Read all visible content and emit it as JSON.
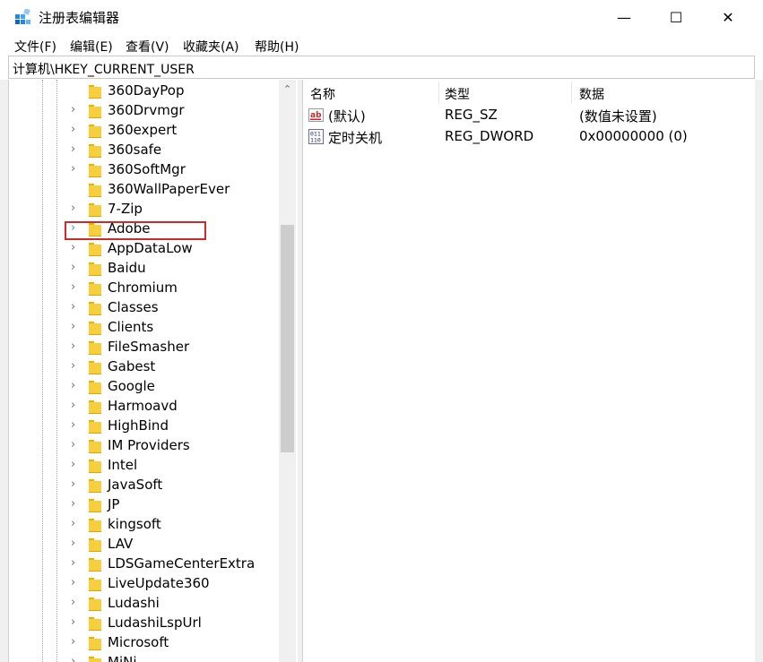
{
  "window": {
    "title": "注册表编辑器",
    "minimize_glyph": "—",
    "maximize_glyph": "☐",
    "close_glyph": "✕"
  },
  "menu": [
    "文件(F)",
    "编辑(E)",
    "查看(V)",
    "收藏夹(A)",
    "帮助(H)"
  ],
  "address": "计算机\\HKEY_CURRENT_USER",
  "tree": {
    "items": [
      {
        "label": "360DayPop",
        "expandable": false
      },
      {
        "label": "360Drvmgr",
        "expandable": true
      },
      {
        "label": "360expert",
        "expandable": true
      },
      {
        "label": "360safe",
        "expandable": true
      },
      {
        "label": "360SoftMgr",
        "expandable": true
      },
      {
        "label": "360WallPaperEver",
        "expandable": false
      },
      {
        "label": "7-Zip",
        "expandable": true
      },
      {
        "label": "Adobe",
        "expandable": true,
        "highlighted": true
      },
      {
        "label": "AppDataLow",
        "expandable": true
      },
      {
        "label": "Baidu",
        "expandable": true
      },
      {
        "label": "Chromium",
        "expandable": true
      },
      {
        "label": "Classes",
        "expandable": true
      },
      {
        "label": "Clients",
        "expandable": true
      },
      {
        "label": "FileSmasher",
        "expandable": true
      },
      {
        "label": "Gabest",
        "expandable": true
      },
      {
        "label": "Google",
        "expandable": true
      },
      {
        "label": "Harmoavd",
        "expandable": true
      },
      {
        "label": "HighBind",
        "expandable": true
      },
      {
        "label": "IM Providers",
        "expandable": true
      },
      {
        "label": "Intel",
        "expandable": true
      },
      {
        "label": "JavaSoft",
        "expandable": true
      },
      {
        "label": "JP",
        "expandable": true
      },
      {
        "label": "kingsoft",
        "expandable": true
      },
      {
        "label": "LAV",
        "expandable": true
      },
      {
        "label": "LDSGameCenterExtra",
        "expandable": true
      },
      {
        "label": "LiveUpdate360",
        "expandable": true
      },
      {
        "label": "Ludashi",
        "expandable": true
      },
      {
        "label": "LudashiLspUrl",
        "expandable": true
      },
      {
        "label": "Microsoft",
        "expandable": true
      },
      {
        "label": "MiNi",
        "expandable": true
      }
    ],
    "scroll_up_glyph": "⌃"
  },
  "values": {
    "headers": [
      "名称",
      "类型",
      "数据"
    ],
    "rows": [
      {
        "name": "(默认)",
        "type": "REG_SZ",
        "data": "(数值未设置)",
        "icon": "string-value-icon"
      },
      {
        "name": "定时关机",
        "type": "REG_DWORD",
        "data": "0x00000000 (0)",
        "icon": "binary-value-icon"
      }
    ]
  },
  "colors": {
    "highlight_border": "#cc2b2b",
    "folder": "#f7cf3d",
    "scroll_thumb": "#cdcdcd"
  }
}
